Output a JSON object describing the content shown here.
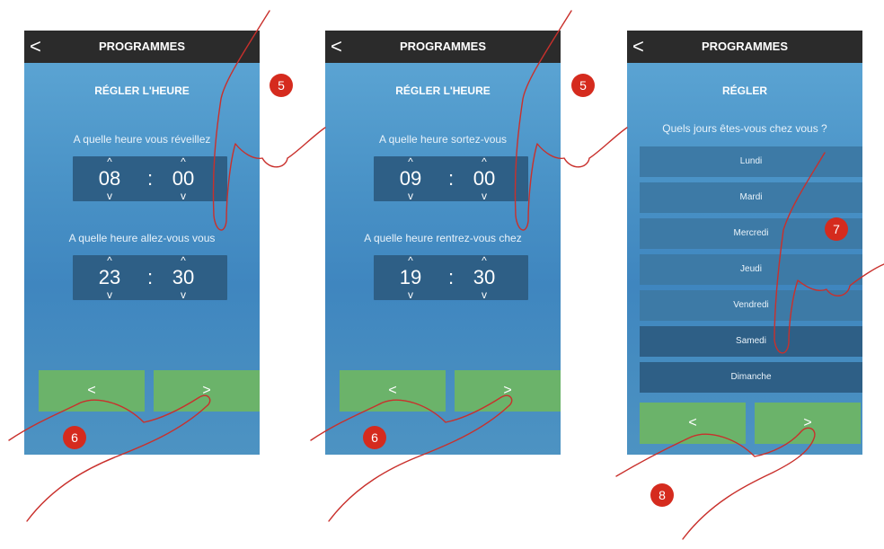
{
  "screens": [
    {
      "back_icon": "chevron-left-icon",
      "title": "PROGRAMMES",
      "subtitle": "RÉGLER L'HEURE",
      "q1": "A quelle heure vous réveillez",
      "t1": {
        "hour": "08",
        "min": "00"
      },
      "q2": "A quelle heure allez-vous vous",
      "t2": {
        "hour": "23",
        "min": "30"
      },
      "prev": "<",
      "next": ">"
    },
    {
      "back_icon": "chevron-left-icon",
      "title": "PROGRAMMES",
      "subtitle": "RÉGLER L'HEURE",
      "q1": "A quelle heure sortez-vous",
      "t1": {
        "hour": "09",
        "min": "00"
      },
      "q2": "A quelle heure rentrez-vous chez",
      "t2": {
        "hour": "19",
        "min": "30"
      },
      "prev": "<",
      "next": ">"
    },
    {
      "back_icon": "chevron-left-icon",
      "title": "PROGRAMMES",
      "subtitle": "RÉGLER",
      "question": "Quels jours êtes-vous chez vous ?",
      "days": [
        "Lundi",
        "Mardi",
        "Mercredi",
        "Jeudi",
        "Vendredi",
        "Samedi",
        "Dimanche"
      ],
      "prev": "<",
      "next": ">"
    }
  ],
  "glyphs": {
    "colon": ":",
    "up": "^",
    "down": "v",
    "back": "<"
  },
  "badges": [
    "5",
    "6",
    "5",
    "6",
    "7",
    "8"
  ],
  "colors": {
    "topbar": "#2b2b2b",
    "screen": "#4a93c7",
    "timebox": "#2e5f86",
    "button": "#6bb36a",
    "badge": "#d52b1e"
  }
}
